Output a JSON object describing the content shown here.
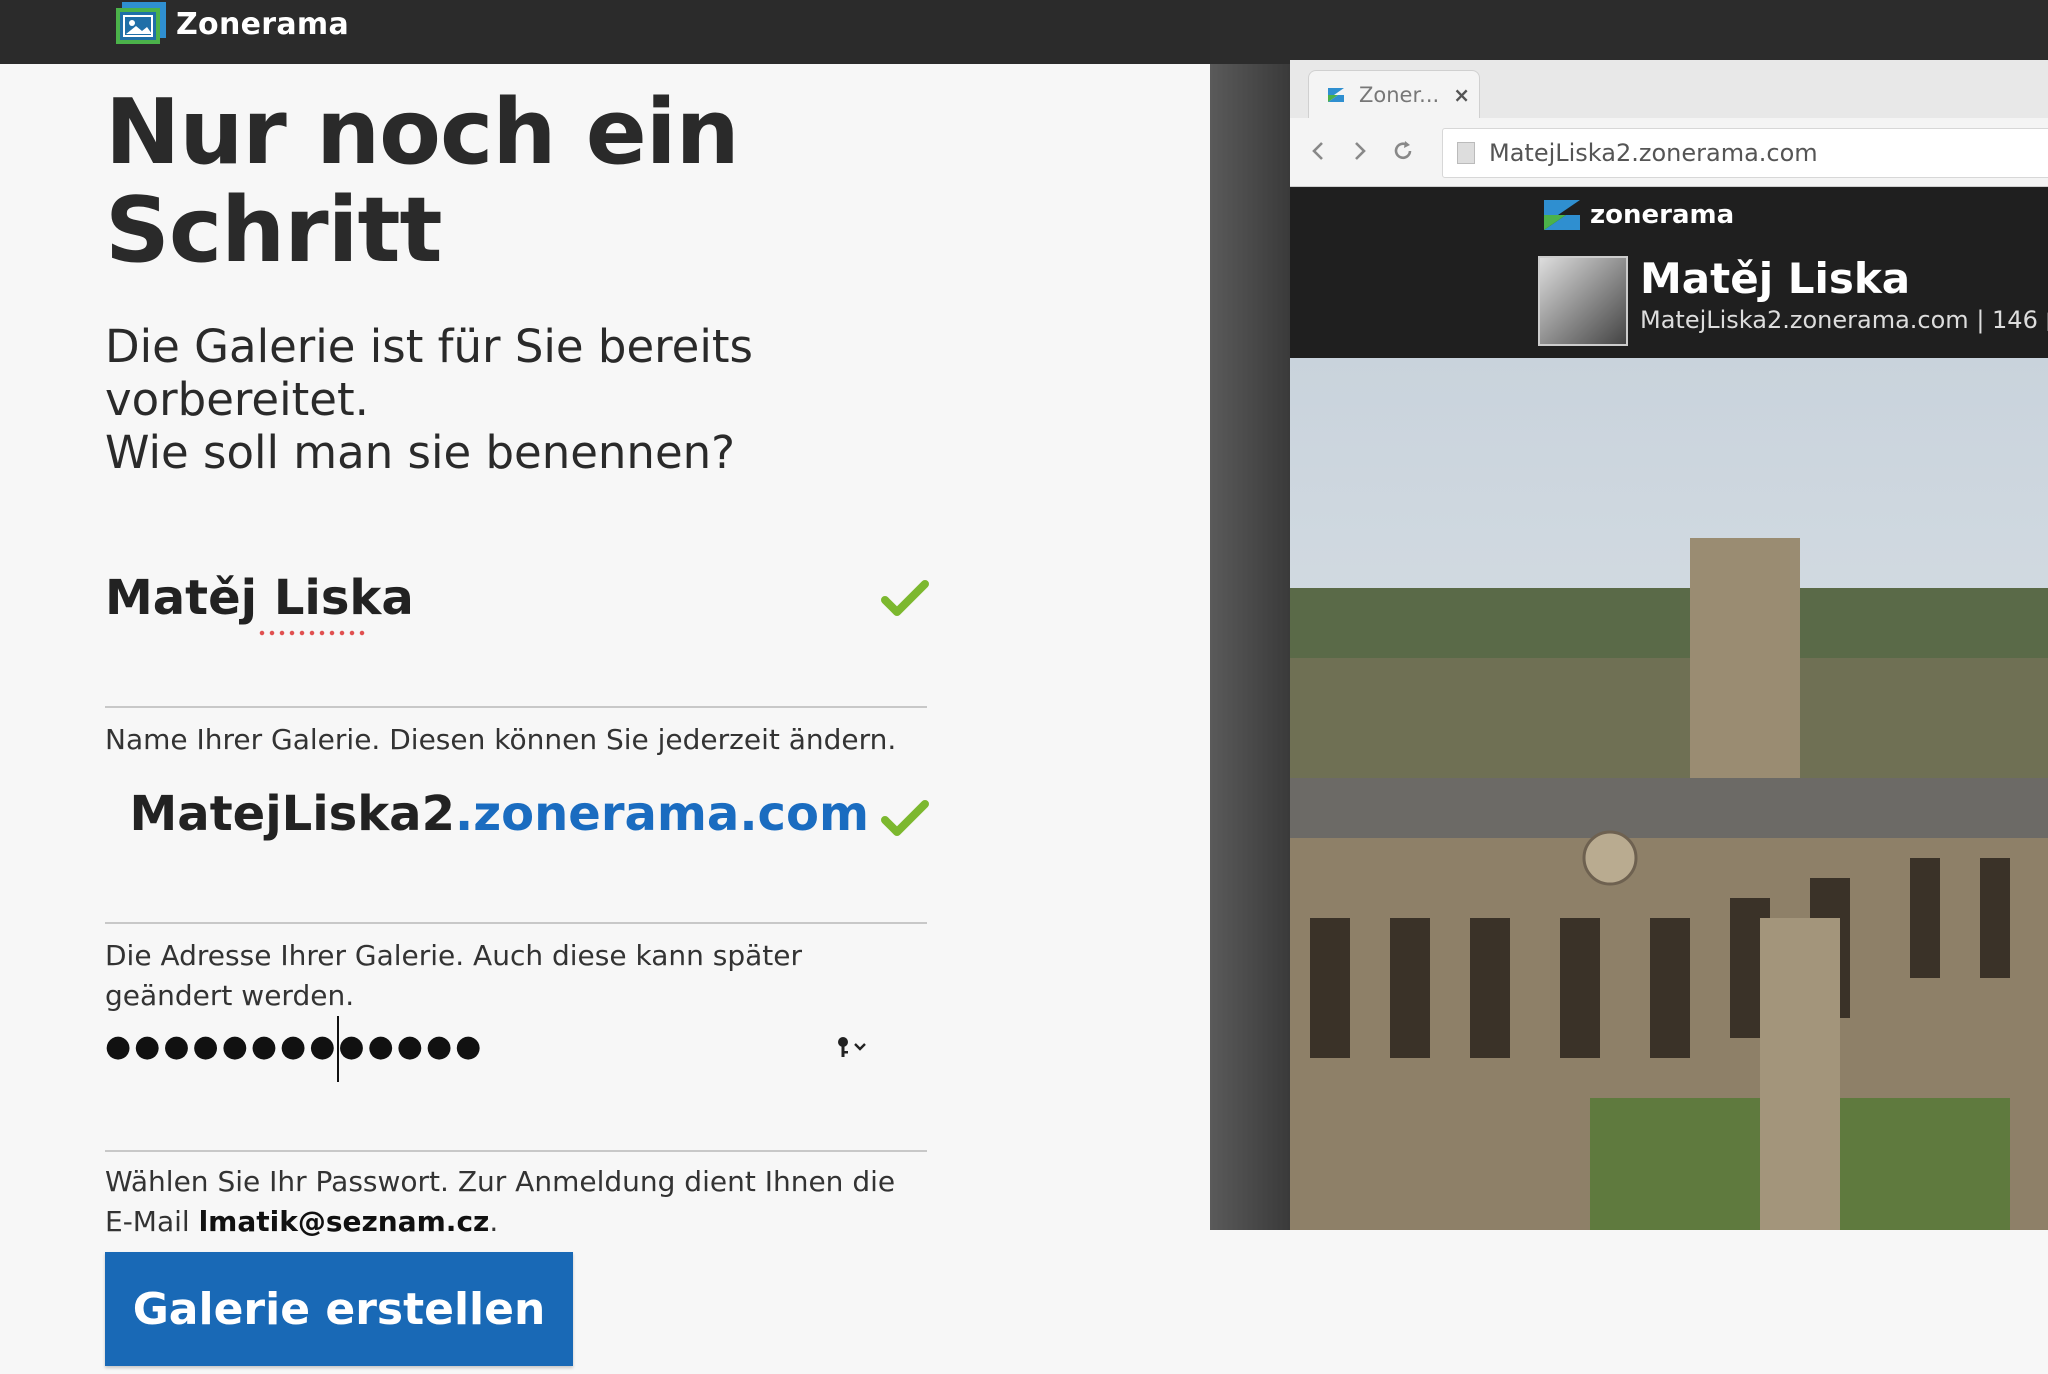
{
  "header": {
    "brand_name": "Zonerama",
    "logo_icon": "zonerama-logo-icon"
  },
  "page": {
    "title": "Nur noch ein Schritt",
    "subtitle_lines": [
      "Die Galerie ist für Sie bereits",
      "vorbereitet.",
      "Wie soll man sie benennen?"
    ]
  },
  "form": {
    "gallery_name": {
      "value": "Matěj Liska",
      "help": "Name Ihrer Galerie. Diesen können Sie jederzeit ändern.",
      "status_icon": "check-icon"
    },
    "gallery_address": {
      "subdomain": "MatejLiska2",
      "domain": ".zonerama.com",
      "help": "Die Adresse Ihrer Galerie. Auch diese kann später geändert werden.",
      "status_icon": "check-icon"
    },
    "password": {
      "masked_value": "●●●●●●●●●●●●●",
      "help_prefix": "Wählen Sie Ihr Passwort. Zur Anmeldung dient Ihnen die E-Mail ",
      "email": "lmatik@seznam.cz",
      "help_suffix": ".",
      "key_icon": "key-icon"
    },
    "submit_label": "Galerie erstellen"
  },
  "preview": {
    "tab_title": "Zoner...",
    "tab_close": "×",
    "url": "MatejLiska2.zonerama.com",
    "site_brand": "zonerama",
    "gallery_name": "Matěj Liska",
    "gallery_sub": "MatejLiska2.zonerama.com | 146"
  },
  "colors": {
    "topbar": "#2b2b2b",
    "accent_blue": "#1969b6",
    "check_green": "#7cb82f",
    "domain_blue": "#1a6cc0"
  }
}
